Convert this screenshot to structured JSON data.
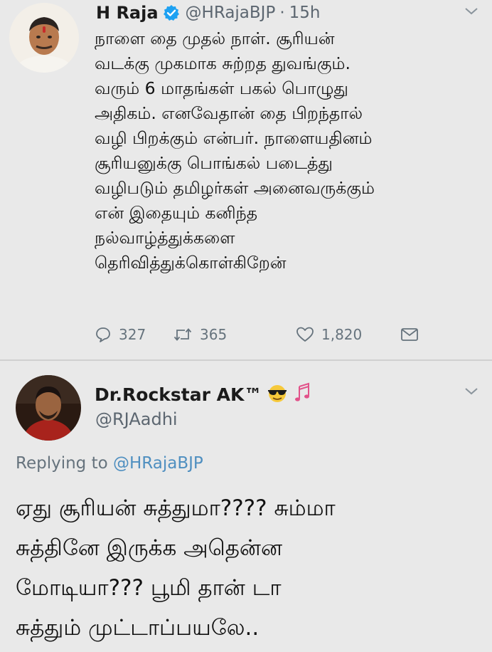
{
  "colors": {
    "background": "#e9e9e9",
    "verified_badge": "#1da1f2",
    "secondary_text": "#5c6670",
    "link": "#4f8fc0"
  },
  "tweet": {
    "author_name": "H Raja",
    "handle": "@HRajaBJP",
    "separator": "·",
    "time": "15h",
    "body_lines": [
      "நாளை தை முதல் நாள். சூரியன்",
      "வடக்கு முகமாக சுற்றத துவங்கும்.",
      "வரும் 6 மாதங்கள் பகல் பொழுது",
      "அதிகம். எனவேதான் தை பிறந்தால்",
      "வழி பிறக்கும் என்பர். நாளையதினம்",
      "சூரியனுக்கு பொங்கல் படைத்து",
      "வழிபடும் தமிழர்கள் அனைவருக்கும்",
      "என் இதையும் கனிந்த",
      "நல்வாழ்த்துக்களை",
      "தெரிவித்துக்கொள்கிறேன்"
    ],
    "reply_count": "327",
    "retweet_count": "365",
    "like_count": "1,820"
  },
  "reply": {
    "author_name": "Dr.Rockstar AK™",
    "handle": "@RJAadhi",
    "replying_prefix": "Replying to",
    "replying_to": "@HRajaBJP",
    "body_lines": [
      "ஏது சூரியன் சுத்துமா???? சும்மா",
      "சுத்தினே இருக்க அதென்ன",
      "மோடியா??? பூமி தான் டா",
      "சுத்தும் முட்டாப்பயலே.."
    ],
    "name_emojis": [
      "sunglasses-emoji-icon",
      "music-notes-icon"
    ]
  },
  "icons": {
    "verified": "verified-badge-icon",
    "reply": "reply-icon",
    "retweet": "retweet-icon",
    "like": "heart-icon",
    "dm": "envelope-icon",
    "menu": "chevron-down-icon"
  }
}
